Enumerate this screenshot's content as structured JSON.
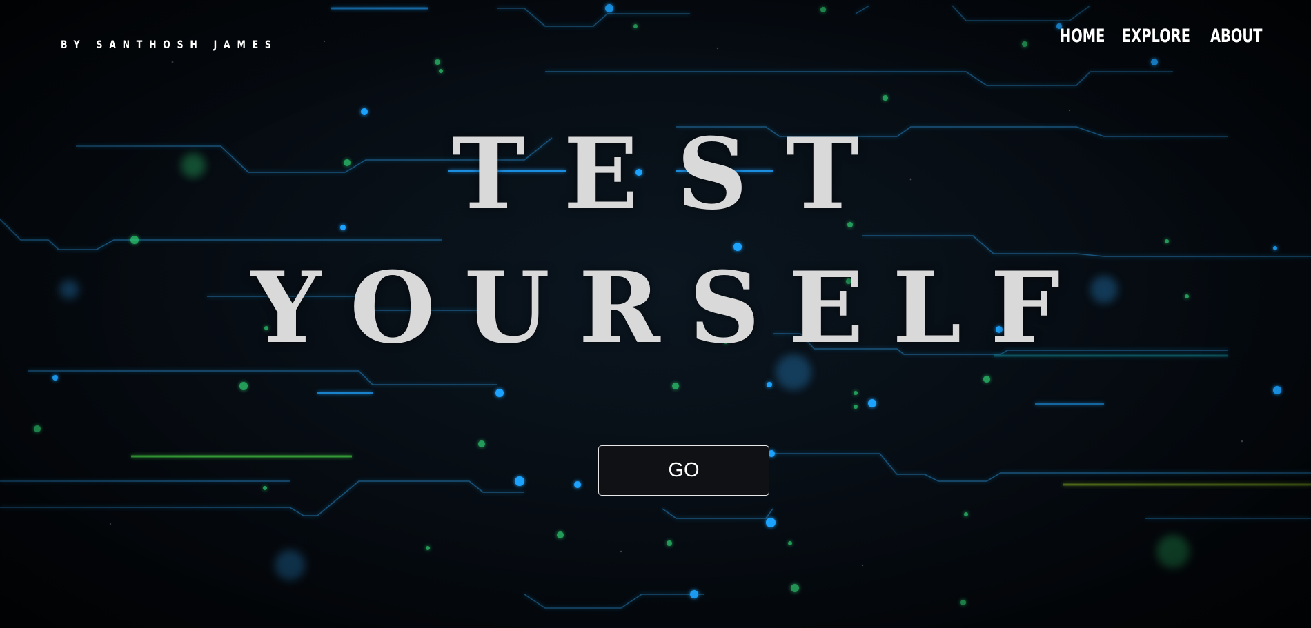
{
  "header": {
    "brand": "BY SANTHOSH JAMES",
    "nav": {
      "home": "HOME",
      "explore": "EXPLORE",
      "about": "ABOUT"
    }
  },
  "hero": {
    "line1": "TEST",
    "line2": "YOURSELF",
    "button_label": "GO"
  },
  "colors": {
    "background": "#05080c",
    "circuit_blue": "#1e90d6",
    "circuit_green": "#2ecc71",
    "title_text": "#d9d9d9",
    "nav_text": "#ffffff"
  },
  "icons": {
    "background": "circuit-board-illustration"
  }
}
